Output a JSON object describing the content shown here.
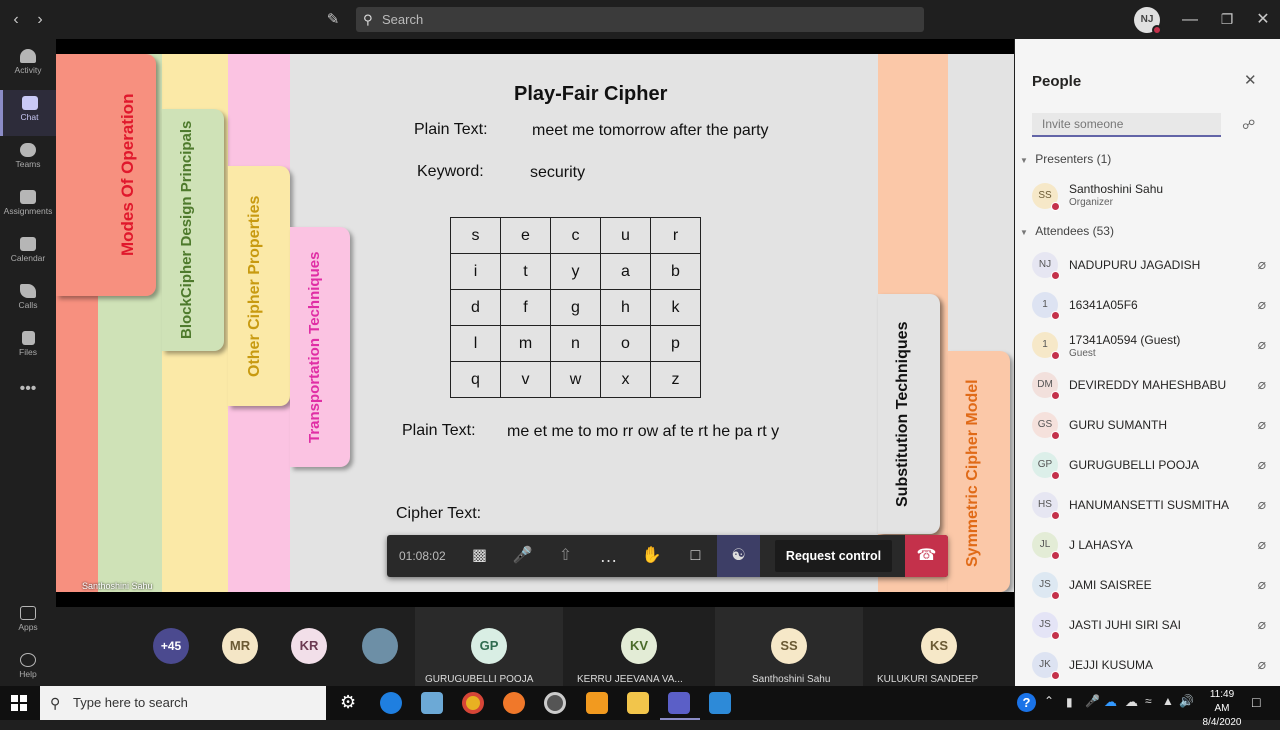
{
  "titlebar": {
    "search_placeholder": "Search",
    "user_initials": "NJ",
    "back_icon": "chevron-left-icon",
    "forward_icon": "chevron-right-icon",
    "compose_icon": "compose-icon"
  },
  "rail": {
    "items": [
      {
        "label": "Activity",
        "icon": "bell-icon"
      },
      {
        "label": "Chat",
        "icon": "chat-icon"
      },
      {
        "label": "Teams",
        "icon": "teams-icon"
      },
      {
        "label": "Assignments",
        "icon": "assignments-icon"
      },
      {
        "label": "Calendar",
        "icon": "calendar-icon"
      },
      {
        "label": "Calls",
        "icon": "phone-icon"
      },
      {
        "label": "Files",
        "icon": "file-icon"
      },
      {
        "label": "Apps",
        "icon": "apps-icon"
      },
      {
        "label": "Help",
        "icon": "help-icon"
      }
    ],
    "more": "•••"
  },
  "slide": {
    "title": "Play-Fair Cipher",
    "plain_label": "Plain Text:",
    "plain_value": "meet me tomorrow after the party",
    "keyword_label": "Keyword:",
    "keyword_value": "security",
    "matrix": [
      [
        "s",
        "e",
        "c",
        "u",
        "r"
      ],
      [
        "i",
        "t",
        "y",
        "a",
        "b"
      ],
      [
        "d",
        "f",
        "g",
        "h",
        "k"
      ],
      [
        "l",
        "m",
        "n",
        "o",
        "p"
      ],
      [
        "q",
        "v",
        "w",
        "x",
        "z"
      ]
    ],
    "plain2_label": "Plain Text:",
    "plain2_value": "me et me to mo rr ow af te rt he pa rt y",
    "cipher_label": "Cipher Text:",
    "tabs": {
      "modes": "Modes Of Operation",
      "block": "BlockCipher Design Principals",
      "other": "Other Cipher Properties",
      "transport": "Transportation Techniques",
      "substitution": "Substitution Techniques",
      "symmetric": "Symmetric Cipher Model"
    },
    "presenter_watermark": "Santhoshini Sahu"
  },
  "call_bar": {
    "timer": "01:08:02",
    "request_control": "Request control"
  },
  "gallery": {
    "overflow": "+45",
    "avatars": [
      "MR",
      "KR"
    ],
    "tiles": [
      {
        "initials": "GP",
        "name": "GURUGUBELLI POOJA"
      },
      {
        "initials": "KV",
        "name": "KERRU JEEVANA VA..."
      },
      {
        "initials": "SS",
        "name": "Santhoshini Sahu"
      },
      {
        "initials": "KS",
        "name": "KULUKURI SANDEEP"
      }
    ]
  },
  "people": {
    "title": "People",
    "invite_placeholder": "Invite someone",
    "presenters_header": "Presenters (1)",
    "attendees_header": "Attendees (53)",
    "presenter": {
      "initials": "SS",
      "name": "Santhoshini Sahu",
      "role": "Organizer"
    },
    "attendees": [
      {
        "initials": "NJ",
        "name": "NADUPURU JAGADISH",
        "sub": ""
      },
      {
        "initials": "1",
        "name": "16341A05F6",
        "sub": ""
      },
      {
        "initials": "1",
        "name": "17341A0594 (Guest)",
        "sub": "Guest"
      },
      {
        "initials": "DM",
        "name": "DEVIREDDY MAHESHBABU",
        "sub": ""
      },
      {
        "initials": "GS",
        "name": "GURU SUMANTH",
        "sub": ""
      },
      {
        "initials": "GP",
        "name": "GURUGUBELLI POOJA",
        "sub": ""
      },
      {
        "initials": "HS",
        "name": "HANUMANSETTI SUSMITHA",
        "sub": ""
      },
      {
        "initials": "JL",
        "name": "J LAHASYA",
        "sub": ""
      },
      {
        "initials": "JS",
        "name": "JAMI SAISREE",
        "sub": ""
      },
      {
        "initials": "JS",
        "name": "JASTI JUHI SIRI SAI",
        "sub": ""
      },
      {
        "initials": "JK",
        "name": "JEJJI KUSUMA",
        "sub": ""
      }
    ]
  },
  "taskbar": {
    "search_placeholder": "Type here to search",
    "time": "11:49 AM",
    "date": "8/4/2020"
  }
}
